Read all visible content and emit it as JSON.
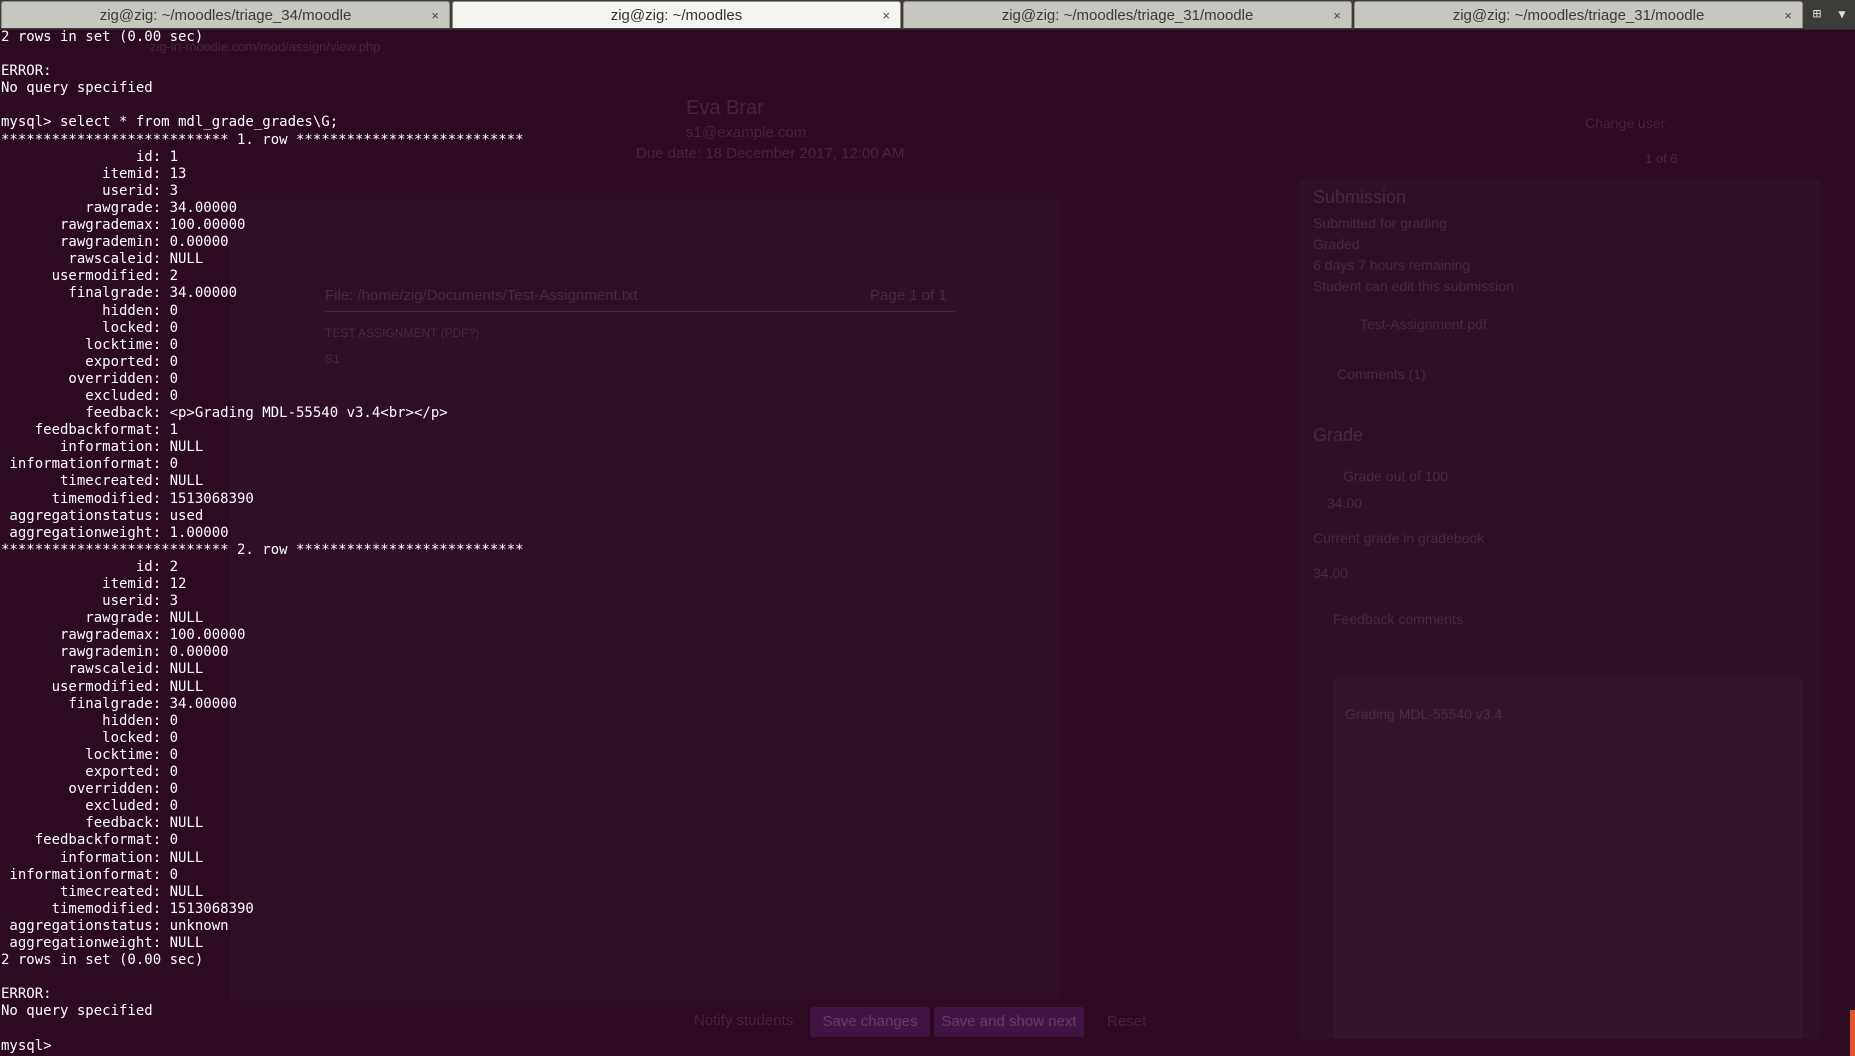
{
  "tabs": [
    {
      "title": "zig@zig: ~/moodles/triage_34/moodle",
      "close": "×",
      "active": false
    },
    {
      "title": "zig@zig: ~/moodles",
      "close": "×",
      "active": true
    },
    {
      "title": "zig@zig: ~/moodles/triage_31/moodle",
      "close": "×",
      "active": false
    },
    {
      "title": "zig@zig: ~/moodles/triage_31/moodle",
      "close": "×",
      "active": false
    }
  ],
  "tabbar_icons": {
    "new_tab": "new-tab-icon",
    "menu": "chevron-down-icon"
  },
  "terminal": {
    "lines": [
      "2 rows in set (0.00 sec)",
      "",
      "ERROR:",
      "No query specified",
      "",
      "mysql> select * from mdl_grade_grades\\G;",
      "*************************** 1. row ***************************",
      "                id: 1",
      "            itemid: 13",
      "            userid: 3",
      "          rawgrade: 34.00000",
      "       rawgrademax: 100.00000",
      "       rawgrademin: 0.00000",
      "        rawscaleid: NULL",
      "      usermodified: 2",
      "        finalgrade: 34.00000",
      "            hidden: 0",
      "            locked: 0",
      "          locktime: 0",
      "          exported: 0",
      "        overridden: 0",
      "          excluded: 0",
      "          feedback: <p>Grading MDL-55540 v3.4<br></p>",
      "    feedbackformat: 1",
      "       information: NULL",
      " informationformat: 0",
      "       timecreated: NULL",
      "      timemodified: 1513068390",
      " aggregationstatus: used",
      " aggregationweight: 1.00000",
      "*************************** 2. row ***************************",
      "                id: 2",
      "            itemid: 12",
      "            userid: 3",
      "          rawgrade: NULL",
      "       rawgrademax: 100.00000",
      "       rawgrademin: 0.00000",
      "        rawscaleid: NULL",
      "      usermodified: NULL",
      "        finalgrade: 34.00000",
      "            hidden: 0",
      "            locked: 0",
      "          locktime: 0",
      "          exported: 0",
      "        overridden: 0",
      "          excluded: 0",
      "          feedback: NULL",
      "    feedbackformat: 0",
      "       information: NULL",
      " informationformat: 0",
      "       timecreated: NULL",
      "      timemodified: 1513068390",
      " aggregationstatus: unknown",
      " aggregationweight: NULL",
      "2 rows in set (0.00 sec)",
      "",
      "ERROR:",
      "No query specified",
      "",
      "mysql> "
    ]
  },
  "background_window": {
    "url": "zig-in-moodle.com/mod/assign/view.php",
    "user_name": "Eva Brar",
    "user_email": "s1@example.com",
    "due_date": "Due date: 18 December 2017, 12:00 AM",
    "change_user": "Change user",
    "user_count": "1 of 6",
    "file_path": "File: /home/zig/Documents/Test-Assignment.txt",
    "page_indicator": "Page 1 of 1",
    "doc_line_1": "TEST ASSIGNMENT (PDF?)",
    "doc_line_2": "S1",
    "submission_heading": "Submission",
    "submission_status": "Submitted for grading",
    "graded_status": "Graded",
    "time_remaining": "6 days 7 hours remaining",
    "edit_status": "Student can edit this submission",
    "file_name": "Test-Assignment.pdf",
    "comments": "Comments (1)",
    "grade_heading": "Grade",
    "grade_label": "Grade out of 100",
    "grade_value": "34.00",
    "gradebook_label": "Current grade in gradebook",
    "gradebook_value": "34.00",
    "feedback_label": "Feedback comments",
    "feedback_text": "Grading MDL-55540 v3.4",
    "notify_label": "Notify students",
    "save_button": "Save changes",
    "save_next_button": "Save and show next",
    "reset_button": "Reset"
  }
}
